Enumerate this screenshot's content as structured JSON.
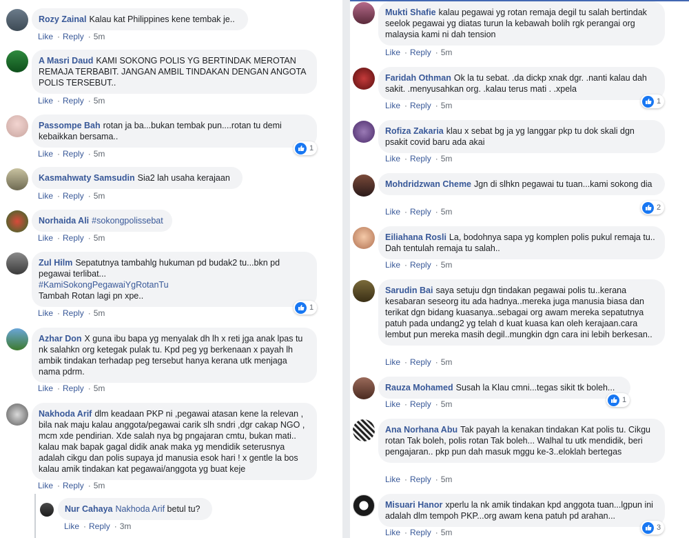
{
  "left_comments": [
    {
      "author": "Rozy Zainal",
      "text": "Kalau kat Philippines kene tembak je..",
      "time": "5m"
    },
    {
      "author": "A Masri Daud",
      "text": "KAMI SOKONG POLIS YG BERTINDAK MEROTAN REMAJA TERBABIT. JANGAN AMBIL TINDAKAN DENGAN ANGOTA POLIS TERSEBUT..",
      "time": "5m"
    },
    {
      "author": "Passompe Bah",
      "text": "rotan ja ba...bukan tembak pun....rotan tu demi kebaikkan bersama..",
      "time": "5m",
      "reactions": "1"
    },
    {
      "author": "Kasmahwaty Samsudin",
      "text": "Sia2 lah usaha kerajaan",
      "time": "5m"
    },
    {
      "author": "Norhaida Ali",
      "text": "#sokongpolissebat",
      "time": "5m"
    },
    {
      "author": "Zul Hilm",
      "text": "Sepatutnya tambahlg hukuman pd budak2 tu...bkn pd pegawai terlibat...",
      "hashtag": "#KamiSokongPegawaiYgRotanTu",
      "text2": "Tambah Rotan lagi pn xpe..",
      "time": "5m",
      "reactions": "1"
    },
    {
      "author": "Azhar Don",
      "text": "X guna ibu bapa yg menyalak dh lh x reti jga anak lpas tu nk salahkn org ketegak pulak tu. Kpd peg yg berkenaan x payah lh ambik tindakan terhadap peg tersebut hanya kerana utk menjaga nama pdrm.",
      "time": "5m"
    },
    {
      "author": "Nakhoda Arif",
      "text": "dlm keadaan PKP ni ,pegawai atasan kene la relevan , bila nak maju kalau anggota/pegawai carik slh sndri ,dgr cakap NGO , mcm xde pendirian. Xde salah nya bg pngajaran cmtu, bukan mati.. kalau mak bapak gagal didik anak maka yg mendidik seterusnya adalah cikgu dan polis supaya jd manusia esok hari ! x gentle la bos kalau amik tindakan kat pegawai/anggota yg buat keje",
      "time": "5m"
    }
  ],
  "reply": {
    "author": "Nur Cahaya",
    "mention": "Nakhoda Arif",
    "text": "betul tu?",
    "time": "3m"
  },
  "right_comments": [
    {
      "author": "Mukti Shafie",
      "text": "kalau pegawai yg rotan remaja degil tu salah bertindak seelok pegawai yg diatas turun la kebawah bolih rgk perangai org malaysia kami ni dah tension",
      "time": "5m"
    },
    {
      "author": "Faridah Othman",
      "text": "Ok la tu sebat. .da dickp xnak dgr. .nanti kalau dah sakit. .menyusahkan org. .kalau terus mati . .xpela",
      "time": "5m",
      "reactions": "1"
    },
    {
      "author": "Rofiza Zakaria",
      "text": "klau x sebat bg ja yg langgar pkp tu dok skali dgn psakit covid baru ada akai",
      "time": "5m"
    },
    {
      "author": "Mohdridzwan Cheme",
      "text": "Jgn di slhkn pegawai tu tuan...kami sokong dia",
      "time": "5m",
      "reactions": "2"
    },
    {
      "author": "Eiliahana Rosli",
      "text": "La, bodohnya sapa yg komplen polis pukul remaja tu.. Dah tentulah remaja tu salah..",
      "time": "5m"
    },
    {
      "author": "Sarudin Bai",
      "text": "saya setuju dgn tindakan pegawai polis tu..kerana kesabaran seseorg itu ada hadnya..mereka juga manusia biasa dan terikat dgn bidang kuasanya..sebagai org awam mereka sepatutnya patuh pada undang2 yg telah d kuat kuasa kan oleh kerajaan.cara lembut pun mereka masih degil..mungkin dgn cara ini lebih berkesan..",
      "time": "5m"
    },
    {
      "author": "Rauza Mohamed",
      "text": "Susah la Klau cmni...tegas sikit tk boleh...",
      "time": "5m",
      "reactions": "1"
    },
    {
      "author": "Ana Norhana Abu",
      "text": "Tak payah la kenakan tindakan Kat polis tu. Cikgu rotan Tak boleh, polis rotan Tak boleh... Walhal tu utk mendidik, beri pengajaran.. pkp pun dah masuk mggu ke-3..eloklah bertegas",
      "time": "5m"
    },
    {
      "author": "Misuari Hanor",
      "text": "xperlu la nk amik tindakan kpd anggota tuan...lgpun ini adalah dlm tempoh PKP...org awam kena patuh pd arahan...",
      "time": "5m",
      "reactions": "3"
    }
  ],
  "labels": {
    "like": "Like",
    "reply": "Reply"
  },
  "colors": {
    "author": "#385898",
    "bubble": "#f2f3f5",
    "like_badge": "#1877f2"
  }
}
